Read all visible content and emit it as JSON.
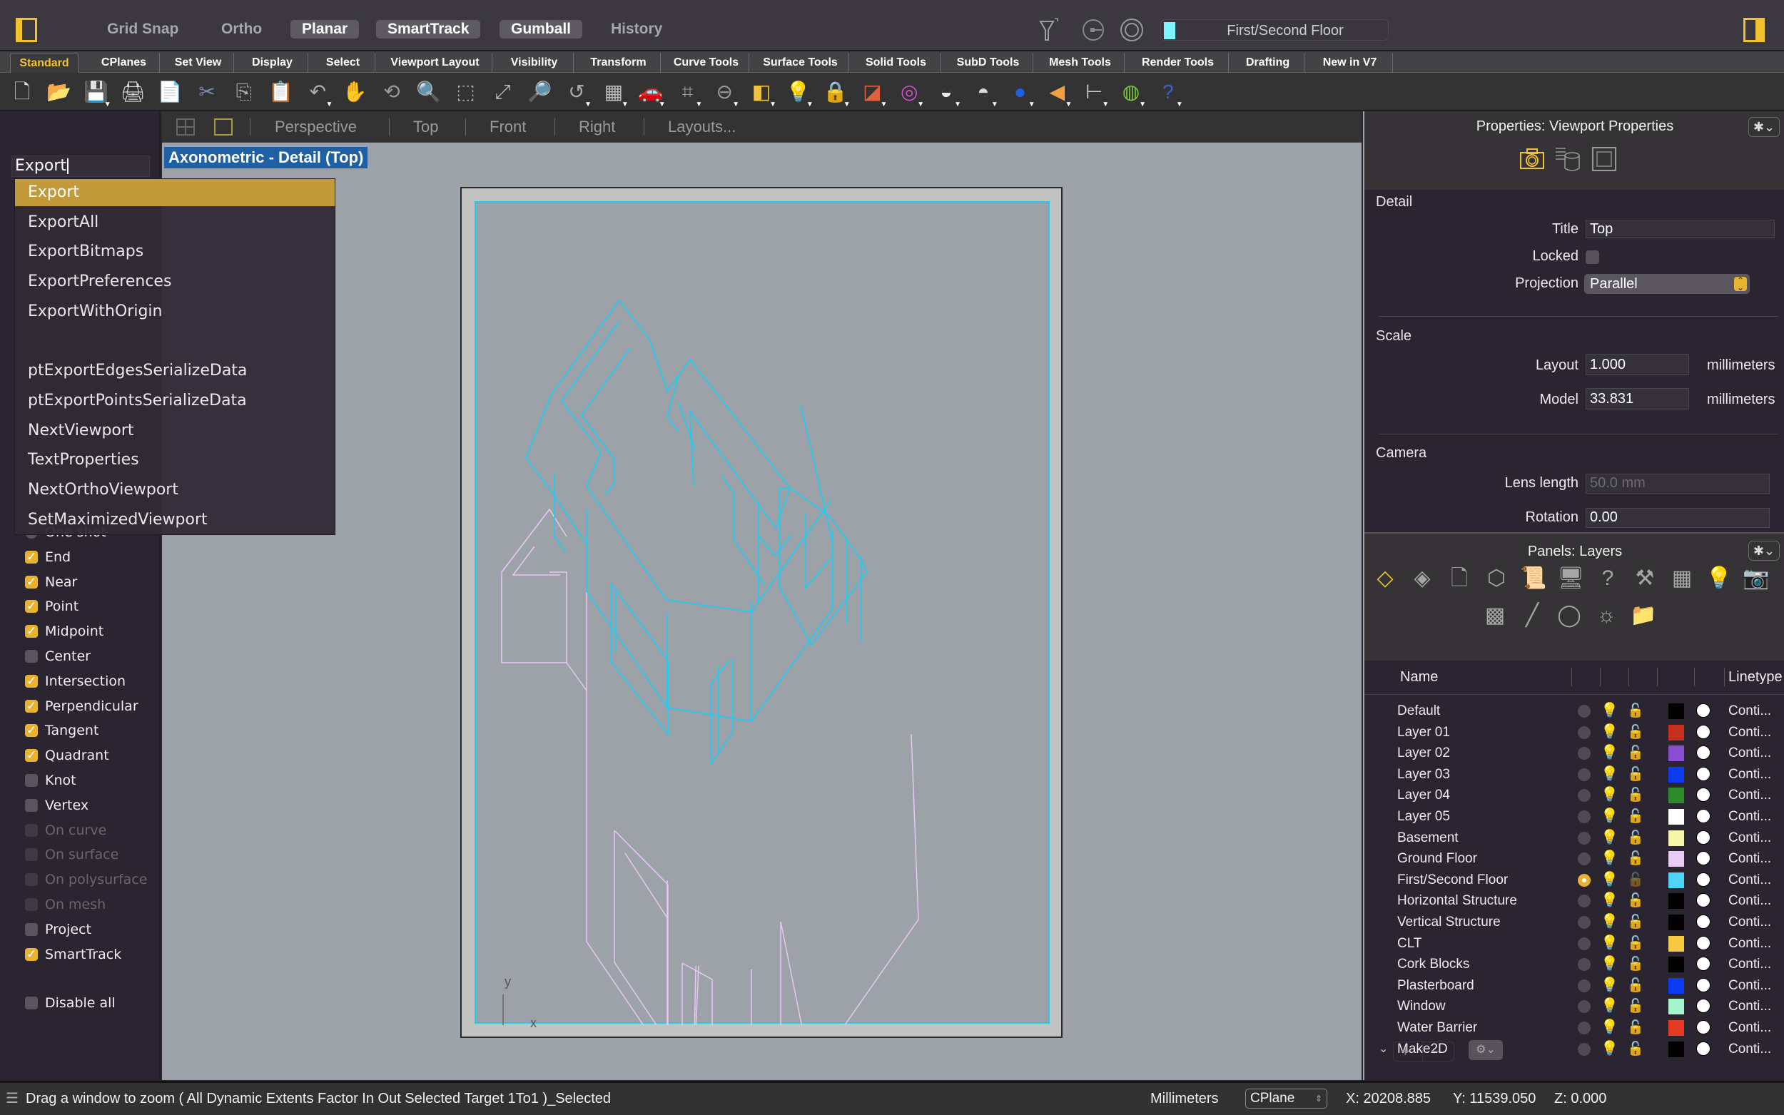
{
  "titlebar": {
    "modes": [
      {
        "label": "Grid Snap",
        "active": false
      },
      {
        "label": "Ortho",
        "active": false
      },
      {
        "label": "Planar",
        "active": true
      },
      {
        "label": "SmartTrack",
        "active": true
      },
      {
        "label": "Gumball",
        "active": true
      },
      {
        "label": "History",
        "active": false
      }
    ],
    "icons": [
      "selection-filter-icon",
      "osnap-icon",
      "record-icon"
    ],
    "current_layer": {
      "label": "First/Second Floor",
      "color": "#7ff3ff"
    }
  },
  "tabs": [
    "Standard",
    "CPlanes",
    "Set View",
    "Display",
    "Select",
    "Viewport Layout",
    "Visibility",
    "Transform",
    "Curve Tools",
    "Surface Tools",
    "Solid Tools",
    "SubD Tools",
    "Mesh Tools",
    "Render Tools",
    "Drafting",
    "New in V7"
  ],
  "active_tab": "Standard",
  "toolbar_icons": [
    {
      "name": "new-file-icon",
      "glyph": "🗋"
    },
    {
      "name": "open-folder-icon",
      "glyph": "📂"
    },
    {
      "name": "save-icon",
      "glyph": "💾"
    },
    {
      "name": "print-icon",
      "glyph": "🖨"
    },
    {
      "name": "import-icon",
      "glyph": "📄"
    },
    {
      "name": "cut-icon",
      "glyph": "✂"
    },
    {
      "name": "copy-icon",
      "glyph": "⎘"
    },
    {
      "name": "paste-icon",
      "glyph": "📋"
    },
    {
      "name": "undo-icon",
      "glyph": "↶"
    },
    {
      "name": "pan-hand-icon",
      "glyph": "✋"
    },
    {
      "name": "rotate-view-icon",
      "glyph": "⟲"
    },
    {
      "name": "zoom-dynamic-icon",
      "glyph": "🔍"
    },
    {
      "name": "zoom-window-icon",
      "glyph": "⬚"
    },
    {
      "name": "zoom-extents-icon",
      "glyph": "⤢"
    },
    {
      "name": "zoom-selected-icon",
      "glyph": "🔎"
    },
    {
      "name": "undo-view-icon",
      "glyph": "↺"
    },
    {
      "name": "viewport-layout-icon",
      "glyph": "▦"
    },
    {
      "name": "car-icon",
      "glyph": "🚗"
    },
    {
      "name": "cplane-icon",
      "glyph": "⌗"
    },
    {
      "name": "osnap-icon",
      "glyph": "⊖"
    },
    {
      "name": "object-props-icon",
      "glyph": "◧"
    },
    {
      "name": "light-bulb-icon",
      "glyph": "💡"
    },
    {
      "name": "lock-icon",
      "glyph": "🔒"
    },
    {
      "name": "layer-icon",
      "glyph": "◪"
    },
    {
      "name": "color-wheel-icon",
      "glyph": "◎"
    },
    {
      "name": "shaded-sphere-icon",
      "glyph": "◒"
    },
    {
      "name": "wire-sphere-icon",
      "glyph": "◓"
    },
    {
      "name": "render-sphere-icon",
      "glyph": "●"
    },
    {
      "name": "cone-icon",
      "glyph": "◀"
    },
    {
      "name": "dimension-icon",
      "glyph": "⊢"
    },
    {
      "name": "grasshopper-icon",
      "glyph": "◍"
    },
    {
      "name": "help-icon",
      "glyph": "?"
    }
  ],
  "viewport_tabs": [
    "Perspective",
    "Top",
    "Front",
    "Right",
    "Layouts..."
  ],
  "viewport": {
    "title": "Axonometric - Detail (Top)",
    "axis_x": "x",
    "axis_y": "y"
  },
  "command": {
    "input_value": "Export",
    "suggestions": [
      "Export",
      "ExportAll",
      "ExportBitmaps",
      "ExportPreferences",
      "ExportWithOrigin",
      "",
      "ptExportEdgesSerializeData",
      "ptExportPointsSerializeData",
      "NextViewport",
      "TextProperties",
      "NextOrthoViewport",
      "SetMaximizedViewport"
    ],
    "selected_index": 0
  },
  "osnap": {
    "items": [
      {
        "label": "One shot",
        "checked": false,
        "radio": true,
        "partial": true
      },
      {
        "label": "End",
        "checked": true
      },
      {
        "label": "Near",
        "checked": true
      },
      {
        "label": "Point",
        "checked": true
      },
      {
        "label": "Midpoint",
        "checked": true
      },
      {
        "label": "Center",
        "checked": false
      },
      {
        "label": "Intersection",
        "checked": true
      },
      {
        "label": "Perpendicular",
        "checked": true
      },
      {
        "label": "Tangent",
        "checked": true
      },
      {
        "label": "Quadrant",
        "checked": true
      },
      {
        "label": "Knot",
        "checked": false
      },
      {
        "label": "Vertex",
        "checked": false
      },
      {
        "label": "On curve",
        "checked": false,
        "disabled": true
      },
      {
        "label": "On surface",
        "checked": false,
        "disabled": true
      },
      {
        "label": "On polysurface",
        "checked": false,
        "disabled": true
      },
      {
        "label": "On mesh",
        "checked": false,
        "disabled": true
      },
      {
        "label": "Project",
        "checked": false
      },
      {
        "label": "SmartTrack",
        "checked": true
      }
    ],
    "disable_all": {
      "label": "Disable all",
      "checked": false
    }
  },
  "properties": {
    "title": "Properties: Viewport Properties",
    "tab_icons": [
      "camera-icon",
      "database-icon",
      "frame-icon"
    ],
    "detail": {
      "section": "Detail",
      "title_label": "Title",
      "title_value": "Top",
      "locked_label": "Locked",
      "locked": false,
      "projection_label": "Projection",
      "projection_value": "Parallel"
    },
    "scale": {
      "section": "Scale",
      "layout_label": "Layout",
      "layout_value": "1.000",
      "layout_unit": "millimeters",
      "model_label": "Model",
      "model_value": "33.831",
      "model_unit": "millimeters"
    },
    "camera": {
      "section": "Camera",
      "lens_label": "Lens length",
      "lens_value": "50.0 mm",
      "rotation_label": "Rotation",
      "rotation_value": "0.00"
    }
  },
  "layers_panel": {
    "title": "Panels: Layers",
    "tool_icons": [
      "layers-icon",
      "layer-states-icon",
      "page-icon",
      "cube-icon",
      "scroll-icon",
      "display-icon",
      "help-circle-icon",
      "drafting-tools-icon",
      "grid-page-icon",
      "lightbulb-outline-icon",
      "camera-icon",
      "grid-icon",
      "tube-icon",
      "sphere-drag-icon",
      "sun-icon",
      "folder-icon"
    ],
    "columns": {
      "name": "Name",
      "linetype": "Linetype"
    },
    "rows": [
      {
        "name": "Default",
        "color": "#000000",
        "on": true,
        "current": false,
        "linetype": "Conti..."
      },
      {
        "name": "Layer 01",
        "color": "#c8301e",
        "on": true,
        "current": false,
        "linetype": "Conti..."
      },
      {
        "name": "Layer 02",
        "color": "#8a4fd0",
        "on": true,
        "current": false,
        "linetype": "Conti..."
      },
      {
        "name": "Layer 03",
        "color": "#0b3cf2",
        "on": true,
        "current": false,
        "linetype": "Conti..."
      },
      {
        "name": "Layer 04",
        "color": "#2e8a2a",
        "on": true,
        "current": false,
        "linetype": "Conti..."
      },
      {
        "name": "Layer 05",
        "color": "#ffffff",
        "on": true,
        "current": false,
        "linetype": "Conti..."
      },
      {
        "name": "Basement",
        "color": "#f6f5a8",
        "on": false,
        "current": false,
        "linetype": "Conti..."
      },
      {
        "name": "Ground Floor",
        "color": "#eaccf5",
        "on": true,
        "current": false,
        "linetype": "Conti..."
      },
      {
        "name": "First/Second Floor",
        "color": "#4fd4f7",
        "on": true,
        "current": true,
        "linetype": "Conti..."
      },
      {
        "name": "Horizontal Structure",
        "color": "#000000",
        "on": false,
        "current": false,
        "linetype": "Conti..."
      },
      {
        "name": "Vertical Structure",
        "color": "#000000",
        "on": false,
        "current": false,
        "linetype": "Conti..."
      },
      {
        "name": "CLT",
        "color": "#f7c842",
        "on": false,
        "current": false,
        "linetype": "Conti..."
      },
      {
        "name": "Cork Blocks",
        "color": "#000000",
        "on": false,
        "current": false,
        "linetype": "Conti..."
      },
      {
        "name": "Plasterboard",
        "color": "#0b3cf2",
        "on": false,
        "current": false,
        "linetype": "Conti..."
      },
      {
        "name": "Window",
        "color": "#a6f5cf",
        "on": false,
        "current": false,
        "linetype": "Conti..."
      },
      {
        "name": "Water Barrier",
        "color": "#e63b22",
        "on": false,
        "current": false,
        "linetype": "Conti..."
      },
      {
        "name": "Make2D",
        "color": "#000000",
        "on": true,
        "current": false,
        "linetype": "Conti...",
        "expandable": true
      }
    ],
    "footer": {
      "add": "+",
      "remove": "−"
    }
  },
  "statusbar": {
    "prompt": "Drag a window to zoom ( All Dynamic Extents Factor In Out Selected Target 1To1 )_Selected",
    "units": "Millimeters",
    "cplane": "CPlane",
    "x": "X: 20208.885",
    "y": "Y: 11539.050",
    "z": "Z: 0.000"
  }
}
